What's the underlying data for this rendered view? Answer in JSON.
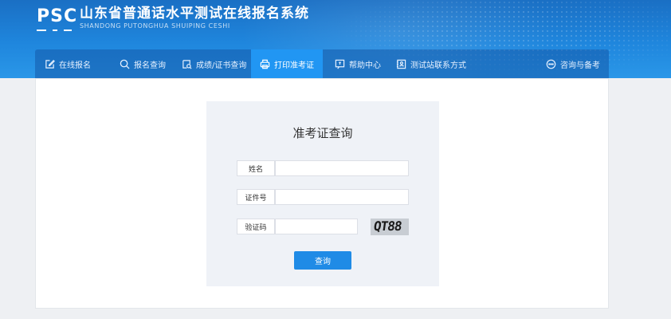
{
  "header": {
    "logo": "PSC",
    "title": "山东省普通话水平测试在线报名系统",
    "subtitle": "SHANDONG PUTONGHUA SHUIPING CESHI"
  },
  "nav": {
    "items": [
      {
        "label": "在线报名",
        "icon": "edit-icon"
      },
      {
        "label": "报名查询",
        "icon": "search-icon"
      },
      {
        "label": "成绩/证书查询",
        "icon": "document-search-icon"
      },
      {
        "label": "打印准考证",
        "icon": "printer-icon"
      },
      {
        "label": "帮助中心",
        "icon": "help-icon"
      },
      {
        "label": "测试站联系方式",
        "icon": "contact-book-icon"
      },
      {
        "label": "咨询与备考",
        "icon": "chat-icon"
      }
    ],
    "active_index": 3
  },
  "form": {
    "title": "准考证查询",
    "name_label": "姓名",
    "name_value": "",
    "id_label": "证件号",
    "id_value": "",
    "captcha_label": "验证码",
    "captcha_value": "",
    "captcha_image_text": "QT88",
    "submit_label": "查询"
  },
  "colors": {
    "header_blue": "#1f86dd",
    "active_tab": "#2196f3",
    "button_blue": "#1f8be6",
    "card_bg": "#eff2f7"
  }
}
